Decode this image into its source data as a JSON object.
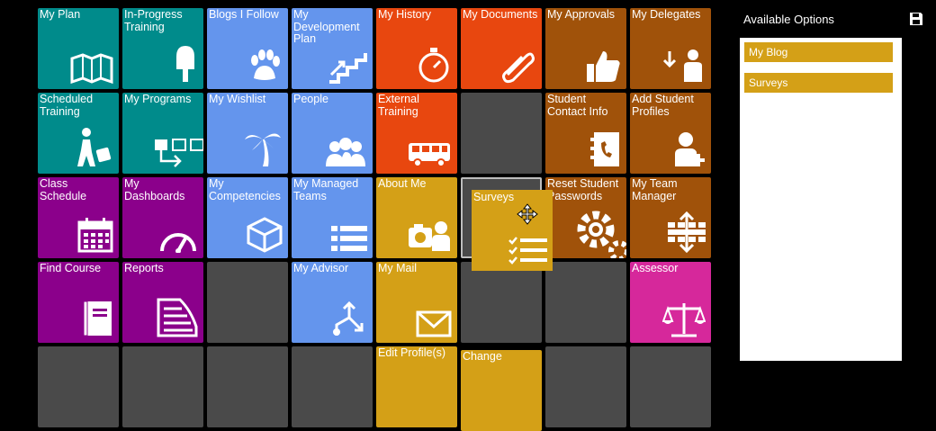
{
  "tiles": {
    "my_plan": "My Plan",
    "in_progress_training": "In-Progress Training",
    "blogs_i_follow": "Blogs I Follow",
    "my_development_plan": "My Development Plan",
    "my_history": "My History",
    "my_documents": "My Documents",
    "my_approvals": "My Approvals",
    "my_delegates": "My Delegates",
    "scheduled_training": "Scheduled Training",
    "my_programs": "My Programs",
    "my_wishlist": "My Wishlist",
    "people": "People",
    "external_training": "External Training",
    "student_contact_info": "Student Contact Info",
    "add_student_profiles": "Add Student Profiles",
    "class_schedule": "Class Schedule",
    "my_dashboards": "My Dashboards",
    "my_competencies": "My Competencies",
    "my_managed_teams": "My Managed Teams",
    "about_me": "About Me",
    "reset_student_passwords": "Reset Student Passwords",
    "my_team_manager": "My Team Manager",
    "find_course": "Find Course",
    "reports": "Reports",
    "my_advisor": "My Advisor",
    "my_mail": "My Mail",
    "assessor": "Assessor",
    "edit_profiles": "Edit Profile(s)",
    "change": "Change"
  },
  "dragging_tile": "Surveys",
  "panel": {
    "title": "Available Options",
    "options": [
      "My Blog",
      "Surveys"
    ]
  },
  "colors": {
    "teal": "#008b8b",
    "blue": "#6495ed",
    "red": "#e8470f",
    "brown": "#a0520a",
    "purple": "#8b008b",
    "gold": "#d4a017",
    "pink": "#d6289b",
    "empty": "#4a4a4a"
  }
}
